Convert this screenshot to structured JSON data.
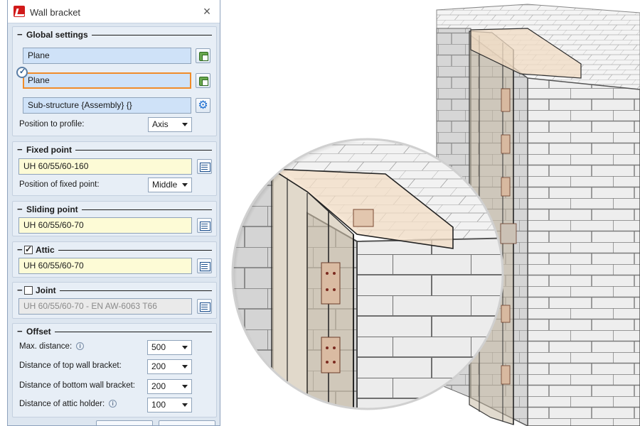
{
  "dialog": {
    "title": "Wall bracket",
    "close_label": "×"
  },
  "global_settings": {
    "title": "Global settings",
    "collapse": "−",
    "field1": "Plane",
    "field2": "Plane",
    "field3": "Sub-structure {Assembly} {}",
    "position_label": "Position to profile:",
    "position_value": "Axis"
  },
  "fixed_point": {
    "title": "Fixed point",
    "collapse": "−",
    "value": "UH 60/55/60-160",
    "position_label": "Position of fixed point:",
    "position_value": "Middle"
  },
  "sliding_point": {
    "title": "Sliding point",
    "collapse": "−",
    "value": "UH 60/55/60-70"
  },
  "attic": {
    "title": "Attic",
    "collapse": "−",
    "checked": true,
    "value": "UH 60/55/60-70"
  },
  "joint": {
    "title": "Joint",
    "collapse": "−",
    "checked": false,
    "value": "UH 60/55/60-70 - EN AW-6063 T66"
  },
  "offset": {
    "title": "Offset",
    "collapse": "−",
    "rows": [
      {
        "label": "Max. distance:",
        "value": "500",
        "info": true
      },
      {
        "label": "Distance of top wall bracket:",
        "value": "200",
        "info": false
      },
      {
        "label": "Distance of bottom wall bracket:",
        "value": "200",
        "info": false
      },
      {
        "label": "Distance of attic holder:",
        "value": "100",
        "info": true
      }
    ]
  },
  "icons": {
    "info": "i"
  },
  "colors": {
    "panel_bg": "#dde6f0",
    "blue_field": "#cfe2f8",
    "yellow_field": "#fdfbd6",
    "focus_border": "#f08c2a"
  }
}
